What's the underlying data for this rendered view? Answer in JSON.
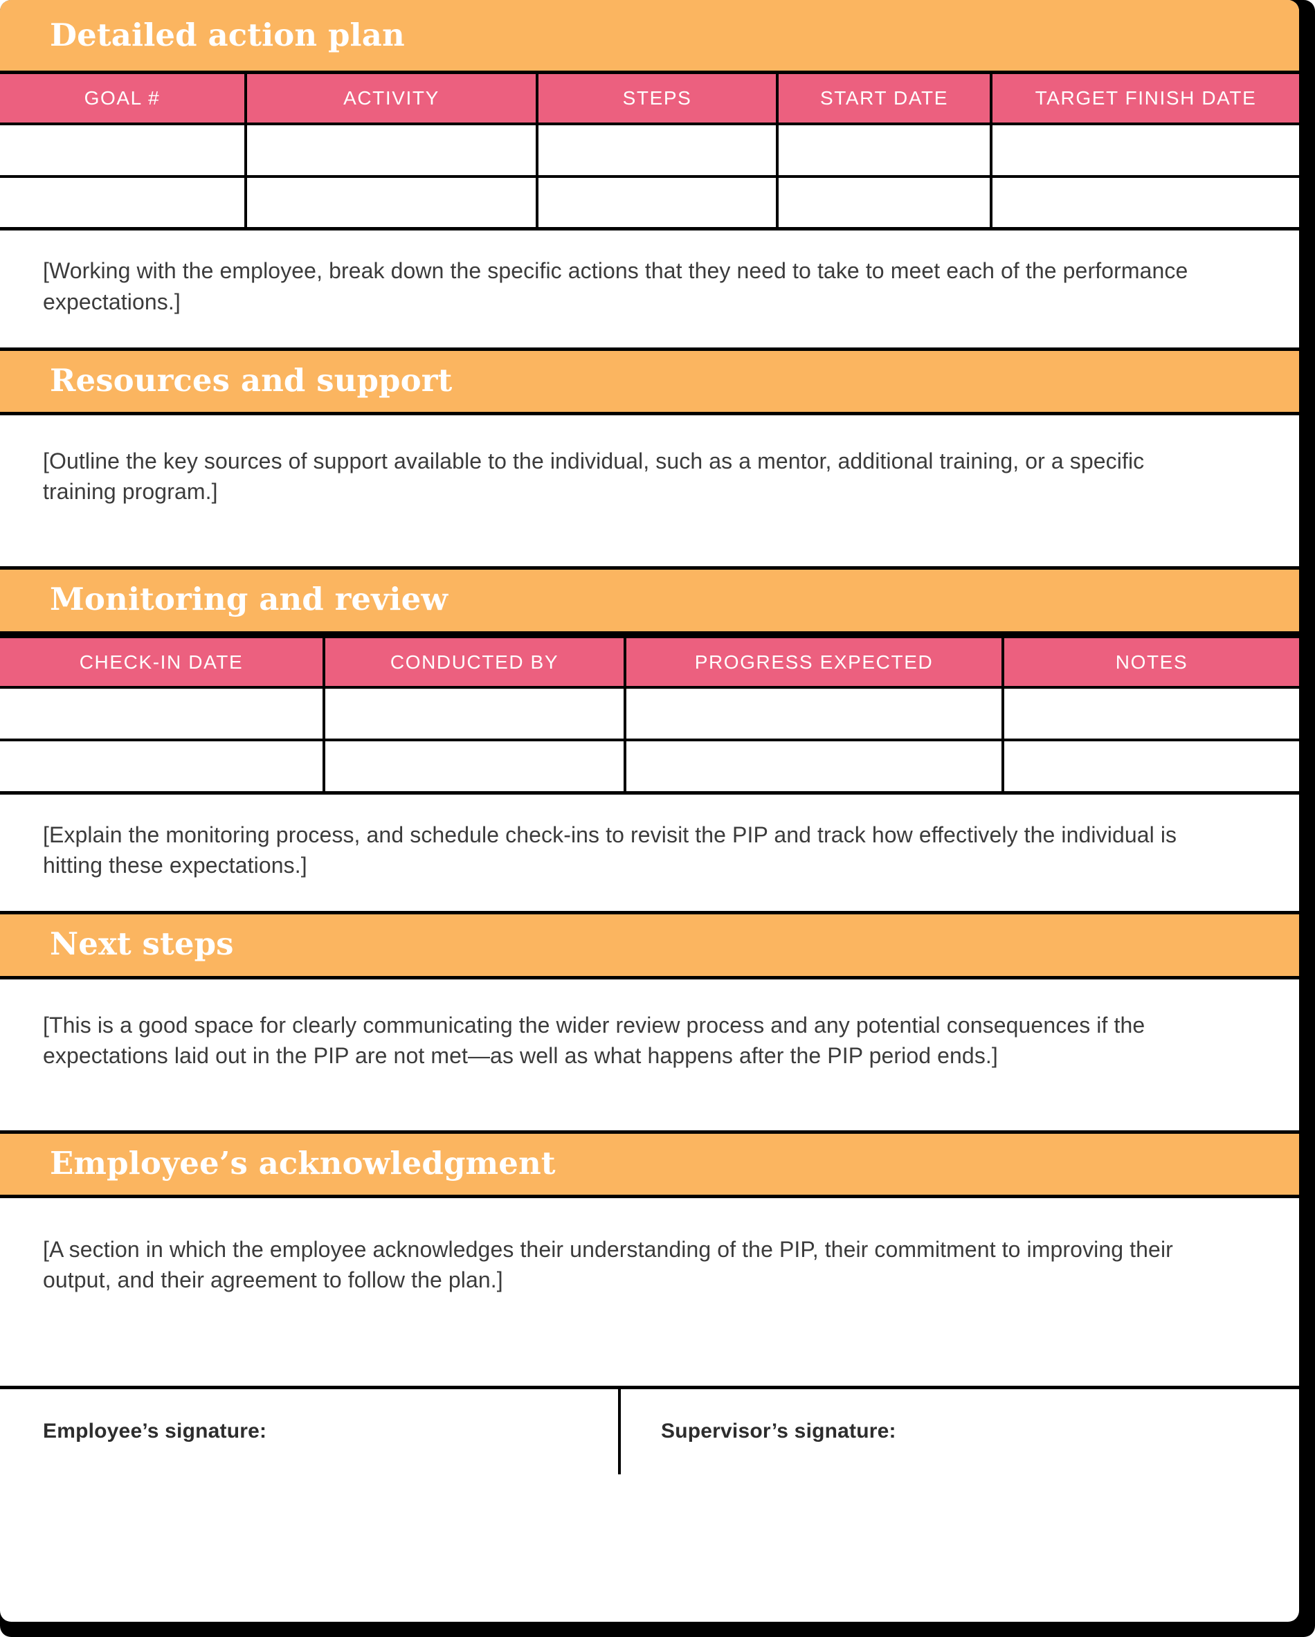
{
  "theme": {
    "header_orange": "#fbb560",
    "table_header_pink": "#ec607f",
    "border_black": "#000000",
    "body_text_gray": "#3b3b3b",
    "header_text_white": "#ffffff"
  },
  "sections": [
    {
      "id": "detailed-action-plan",
      "title": "Detailed action plan",
      "table": {
        "columns": [
          "GOAL #",
          "ACTIVITY",
          "STEPS",
          "START DATE",
          "TARGET FINISH DATE"
        ],
        "rows": [
          [
            "",
            "",
            "",
            "",
            ""
          ],
          [
            "",
            "",
            "",
            "",
            ""
          ]
        ]
      },
      "note": "[Working with the employee, break down the specific actions that they need to take to meet each of the performance expectations.]"
    },
    {
      "id": "resources-and-support",
      "title": "Resources and support",
      "note": "[Outline the key sources of support available to the individual, such as a mentor, additional training, or a specific training program.]"
    },
    {
      "id": "monitoring-and-review",
      "title": "Monitoring and review",
      "table": {
        "columns": [
          "CHECK-IN DATE",
          "CONDUCTED BY",
          "PROGRESS EXPECTED",
          "NOTES"
        ],
        "rows": [
          [
            "",
            "",
            "",
            ""
          ],
          [
            "",
            "",
            "",
            ""
          ]
        ]
      },
      "note": "[Explain the monitoring process, and schedule check-ins to revisit the PIP and track how effectively the individual is hitting these expectations.]"
    },
    {
      "id": "next-steps",
      "title": "Next steps",
      "note": "[This is a good space for clearly communicating the wider review process and any potential consequences if the expectations laid out in the PIP are not met—as well as what happens after the PIP period ends.]"
    },
    {
      "id": "employees-acknowledgment",
      "title": "Employee’s acknowledgment",
      "note": "[A section in which the employee acknowledges their understanding of the PIP, their commitment to improving their output, and their agreement to follow the plan.]"
    }
  ],
  "signatures": {
    "employee_label": "Employee’s signature:",
    "supervisor_label": "Supervisor’s signature:"
  }
}
